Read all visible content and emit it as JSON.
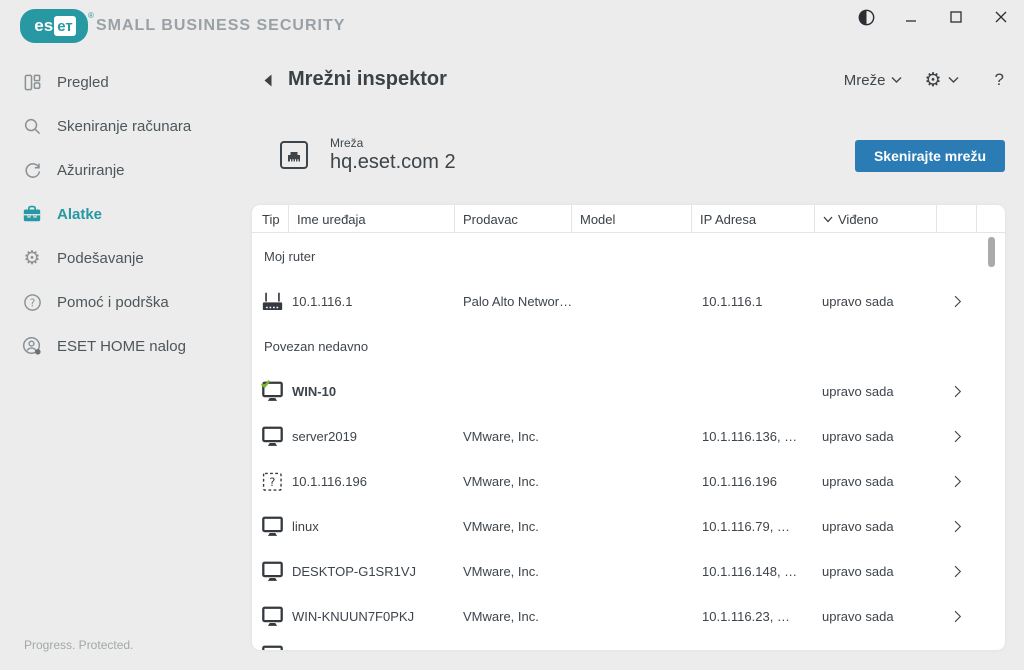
{
  "topbar": {
    "brand": "eset",
    "brand_es": "es",
    "brand_et": "ет",
    "registered_mark": "®",
    "product": "SMALL BUSINESS SECURITY"
  },
  "icons": {
    "contrast-icon": "half-filled circle (theme toggle)",
    "minimize-icon": "horizontal line",
    "maximize-icon": "square outline",
    "close-icon": "x cross",
    "overview-icon": "dashboard panels",
    "search-icon": "magnifying glass",
    "refresh-icon": "circular arrow",
    "toolbox-icon": "filled toolbox (teal)",
    "gear-icon": "cog wheel",
    "help-icon": "question mark in circle",
    "account-icon": "person in circle with dot",
    "back-icon": "left triangle",
    "chevron-down-icon": "v chevron",
    "ethernet-icon": "network port in square",
    "router-icon": "router with antennas",
    "monitor-icon": "desktop monitor",
    "monitor-check-icon": "desktop monitor with green check",
    "unknown-device-icon": "dashed square with question mark",
    "chevron-right-icon": "right angle chevron"
  },
  "sidebar": {
    "items": [
      {
        "icon": "overview-icon",
        "label": "Pregled",
        "active": false
      },
      {
        "icon": "search-icon",
        "label": "Skeniranje računara",
        "active": false
      },
      {
        "icon": "refresh-icon",
        "label": "Ažuriranje",
        "active": false
      },
      {
        "icon": "toolbox-icon",
        "label": "Alatke",
        "active": true
      },
      {
        "icon": "gear-icon",
        "label": "Podešavanje",
        "active": false
      },
      {
        "icon": "help-icon",
        "label": "Pomoć i podrška",
        "active": false
      },
      {
        "icon": "account-icon",
        "label": "ESET HOME nalog",
        "active": false
      }
    ],
    "footer": "Progress. Protected."
  },
  "page_header": {
    "title": "Mrežni inspektor",
    "networks_menu_label": "Mreže",
    "help_label": "?"
  },
  "network": {
    "field_label": "Mreža",
    "name": "hq.eset.com 2",
    "scan_button_label": "Skenirajte mrežu"
  },
  "table": {
    "columns": [
      "Tip",
      "Ime uređaja",
      "Prodavac",
      "Model",
      "IP Adresa",
      "Viđeno"
    ],
    "sorted_by": "Viđeno",
    "sections": [
      {
        "label": "Moj ruter",
        "rows": [
          {
            "type_icon": "router-icon",
            "name": "10.1.116.1",
            "name_bold": false,
            "vendor": "Palo Alto Networ…",
            "model": "",
            "ip": "10.1.116.1",
            "seen": "upravo sada"
          }
        ]
      },
      {
        "label": "Povezan nedavno",
        "rows": [
          {
            "type_icon": "monitor-check-icon",
            "name": "WIN-10",
            "name_bold": true,
            "vendor": "",
            "model": "",
            "ip": "",
            "seen": "upravo sada"
          },
          {
            "type_icon": "monitor-icon",
            "name": "server2019",
            "name_bold": false,
            "vendor": "VMware, Inc.",
            "model": "",
            "ip": "10.1.116.136, …",
            "seen": "upravo sada"
          },
          {
            "type_icon": "unknown-device-icon",
            "name": "10.1.116.196",
            "name_bold": false,
            "vendor": "VMware, Inc.",
            "model": "",
            "ip": "10.1.116.196",
            "seen": "upravo sada"
          },
          {
            "type_icon": "monitor-icon",
            "name": "linux",
            "name_bold": false,
            "vendor": "VMware, Inc.",
            "model": "",
            "ip": "10.1.116.79, …",
            "seen": "upravo sada"
          },
          {
            "type_icon": "monitor-icon",
            "name": "DESKTOP-G1SR1VJ",
            "name_bold": false,
            "vendor": "VMware, Inc.",
            "model": "",
            "ip": "10.1.116.148, …",
            "seen": "upravo sada"
          },
          {
            "type_icon": "monitor-icon",
            "name": "WIN-KNUUN7F0PKJ",
            "name_bold": false,
            "vendor": "VMware, Inc.",
            "model": "",
            "ip": "10.1.116.23, …",
            "seen": "upravo sada"
          }
        ]
      }
    ]
  },
  "colors": {
    "accent_teal": "#2898a3",
    "button_blue": "#2b7cb5",
    "check_green": "#76b82a",
    "background": "#ebeceb",
    "panel_white": "#ffffff",
    "muted_gray": "#9aa1a6"
  }
}
